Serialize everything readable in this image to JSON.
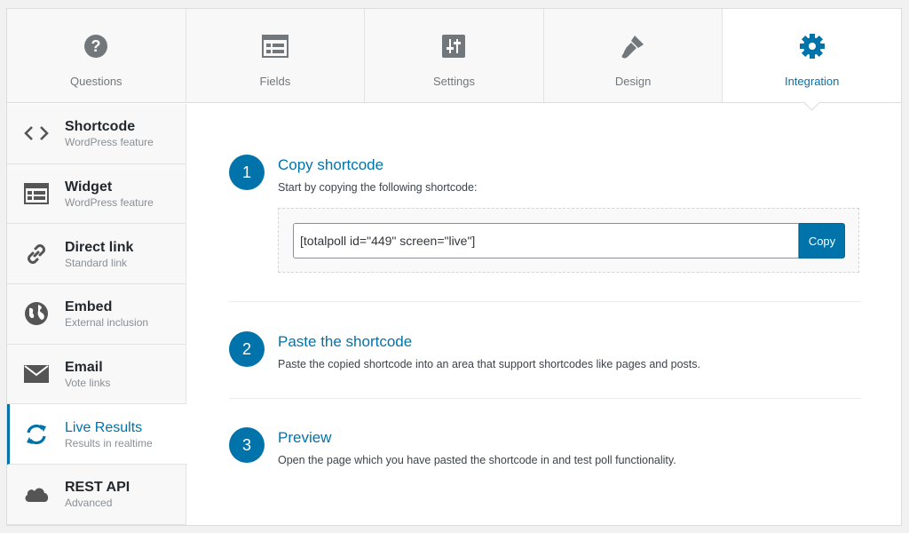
{
  "tabs": [
    {
      "label": "Questions",
      "icon": "question-icon"
    },
    {
      "label": "Fields",
      "icon": "fields-icon"
    },
    {
      "label": "Settings",
      "icon": "settings-sliders-icon"
    },
    {
      "label": "Design",
      "icon": "brush-icon"
    },
    {
      "label": "Integration",
      "icon": "gear-icon",
      "active": true
    }
  ],
  "sidebar": {
    "items": [
      {
        "title": "Shortcode",
        "subtitle": "WordPress feature",
        "icon": "code-icon"
      },
      {
        "title": "Widget",
        "subtitle": "WordPress feature",
        "icon": "widget-icon"
      },
      {
        "title": "Direct link",
        "subtitle": "Standard link",
        "icon": "link-icon"
      },
      {
        "title": "Embed",
        "subtitle": "External inclusion",
        "icon": "globe-icon"
      },
      {
        "title": "Email",
        "subtitle": "Vote links",
        "icon": "envelope-icon"
      },
      {
        "title": "Live Results",
        "subtitle": "Results in realtime",
        "icon": "refresh-icon",
        "active": true
      },
      {
        "title": "REST API",
        "subtitle": "Advanced",
        "icon": "cloud-icon"
      }
    ]
  },
  "steps": [
    {
      "number": "1",
      "title": "Copy shortcode",
      "description": "Start by copying the following shortcode:"
    },
    {
      "number": "2",
      "title": "Paste the shortcode",
      "description": "Paste the copied shortcode into an area that support shortcodes like pages and posts."
    },
    {
      "number": "3",
      "title": "Preview",
      "description": "Open the page which you have pasted the shortcode in and test poll functionality."
    }
  ],
  "shortcode": {
    "value": "[totalpoll id=\"449\" screen=\"live\"]",
    "copy_label": "Copy"
  },
  "colors": {
    "accent": "#0073aa",
    "icon_gray": "#72777c"
  }
}
